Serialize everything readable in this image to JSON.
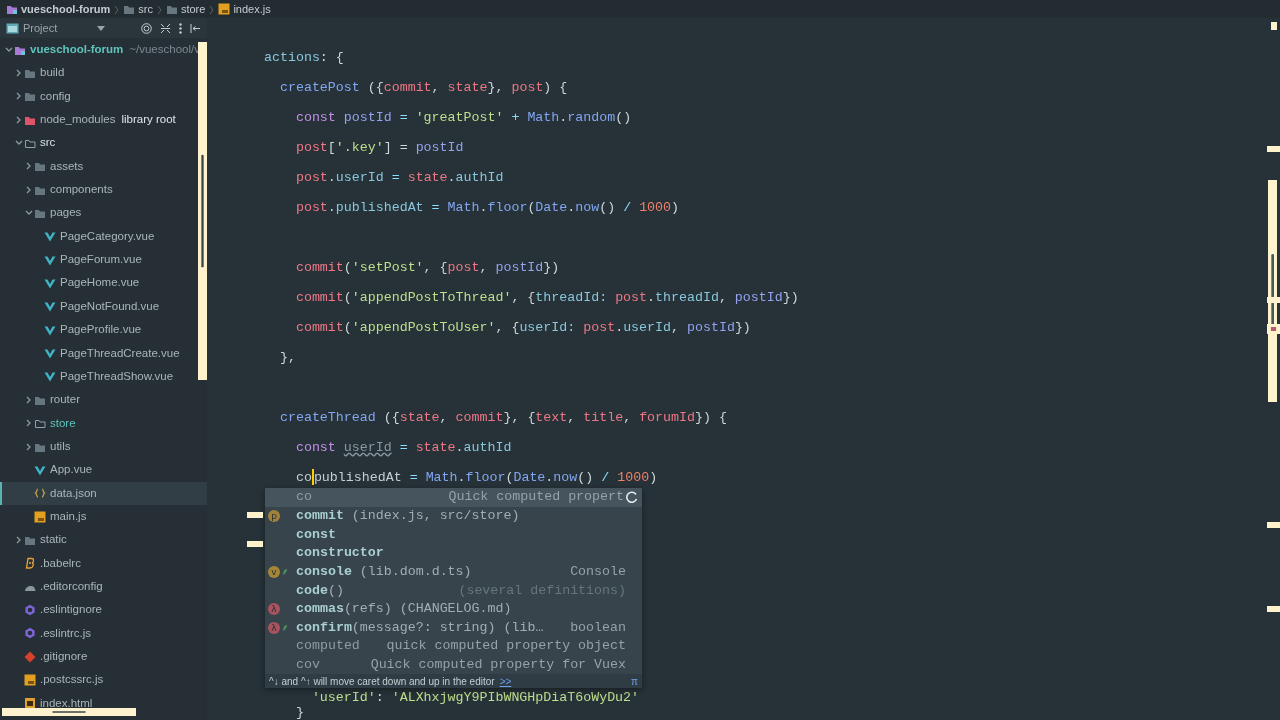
{
  "breadcrumbs": [
    {
      "label": "vueschool-forum",
      "kind": "module"
    },
    {
      "label": "src",
      "kind": "folder"
    },
    {
      "label": "store",
      "kind": "folder"
    },
    {
      "label": "index.js",
      "kind": "js"
    }
  ],
  "project_panel": {
    "title": "Project",
    "tree": [
      {
        "name": "vueschool-forum",
        "note": "~/vueschool/v",
        "kind": "module",
        "expanded": true,
        "selected": false,
        "active": true,
        "children": [
          {
            "name": "build",
            "kind": "folder",
            "expanded": false,
            "selected": false,
            "active": false
          },
          {
            "name": "config",
            "kind": "folder",
            "expanded": false,
            "selected": false,
            "active": false
          },
          {
            "name": "node_modules",
            "note": "library root",
            "kind": "library",
            "expanded": false,
            "selected": false,
            "active": false
          },
          {
            "name": "src",
            "kind": "source",
            "expanded": true,
            "selected": false,
            "active": false,
            "children": [
              {
                "name": "assets",
                "kind": "folder",
                "expanded": false,
                "selected": false,
                "active": false
              },
              {
                "name": "components",
                "kind": "folder",
                "expanded": false,
                "selected": false,
                "active": false
              },
              {
                "name": "pages",
                "kind": "folder",
                "expanded": true,
                "selected": false,
                "active": false,
                "children": [
                  {
                    "name": "PageCategory.vue",
                    "kind": "vue",
                    "selected": false,
                    "active": false
                  },
                  {
                    "name": "PageForum.vue",
                    "kind": "vue",
                    "selected": false,
                    "active": false
                  },
                  {
                    "name": "PageHome.vue",
                    "kind": "vue",
                    "selected": false,
                    "active": false
                  },
                  {
                    "name": "PageNotFound.vue",
                    "kind": "vue",
                    "selected": false,
                    "active": false
                  },
                  {
                    "name": "PageProfile.vue",
                    "kind": "vue",
                    "selected": false,
                    "active": false
                  },
                  {
                    "name": "PageThreadCreate.vue",
                    "kind": "vue",
                    "selected": false,
                    "active": false
                  },
                  {
                    "name": "PageThreadShow.vue",
                    "kind": "vue",
                    "selected": false,
                    "active": false
                  }
                ]
              },
              {
                "name": "router",
                "kind": "folder",
                "expanded": false,
                "selected": false,
                "active": false
              },
              {
                "name": "store",
                "kind": "source",
                "expanded": false,
                "selected": false,
                "active": true
              },
              {
                "name": "utils",
                "kind": "folder",
                "expanded": false,
                "selected": false,
                "active": false
              },
              {
                "name": "App.vue",
                "kind": "vue",
                "selected": false,
                "active": false
              },
              {
                "name": "data.json",
                "kind": "json",
                "selected": true,
                "active": false
              },
              {
                "name": "main.js",
                "kind": "js",
                "selected": false,
                "active": false
              }
            ]
          },
          {
            "name": "static",
            "kind": "folder",
            "expanded": false,
            "selected": false,
            "active": false
          },
          {
            "name": ".babelrc",
            "kind": "babel",
            "selected": false,
            "active": false
          },
          {
            "name": ".editorconfig",
            "kind": "editorconfig",
            "selected": false,
            "active": false
          },
          {
            "name": ".eslintignore",
            "kind": "eslint",
            "selected": false,
            "active": false
          },
          {
            "name": ".eslintrc.js",
            "kind": "eslint",
            "selected": false,
            "active": false
          },
          {
            "name": ".gitignore",
            "kind": "git",
            "selected": false,
            "active": false
          },
          {
            "name": ".postcssrc.js",
            "kind": "js",
            "selected": false,
            "active": false
          },
          {
            "name": "index.html",
            "kind": "html",
            "selected": false,
            "active": false
          }
        ]
      }
    ]
  },
  "editor": {
    "blocks": [
      [
        [
          {
            "t": "actions",
            "kind": "prop"
          },
          {
            "t": ": {",
            "kind": "punc"
          }
        ],
        [
          {
            "t": "  createPost",
            "kind": "fn"
          },
          {
            "t": " ({",
            "kind": "punc"
          },
          {
            "t": "commit",
            "kind": "param"
          },
          {
            "t": ", ",
            "kind": "punc"
          },
          {
            "t": "state",
            "kind": "param"
          },
          {
            "t": "}, ",
            "kind": "punc"
          },
          {
            "t": "post",
            "kind": "param"
          },
          {
            "t": ") {",
            "kind": "punc"
          }
        ],
        [
          {
            "t": "    const ",
            "kind": "kw"
          },
          {
            "t": "postId",
            "kind": "var"
          },
          {
            "t": " = ",
            "kind": "op"
          },
          {
            "t": "'greatPost'",
            "kind": "str"
          },
          {
            "t": " + ",
            "kind": "op"
          },
          {
            "t": "Math",
            "kind": "fn"
          },
          {
            "t": ".",
            "kind": "punc"
          },
          {
            "t": "random",
            "kind": "fn"
          },
          {
            "t": "()",
            "kind": "punc"
          }
        ],
        [
          {
            "t": "    post",
            "kind": "param"
          },
          {
            "t": "[",
            "kind": "punc"
          },
          {
            "t": "'.key'",
            "kind": "str"
          },
          {
            "t": "] = ",
            "kind": "punc"
          },
          {
            "t": "postId",
            "kind": "var"
          }
        ],
        [
          {
            "t": "    post",
            "kind": "param"
          },
          {
            "t": ".",
            "kind": "punc"
          },
          {
            "t": "userId",
            "kind": "prop"
          },
          {
            "t": " = ",
            "kind": "op"
          },
          {
            "t": "state",
            "kind": "param"
          },
          {
            "t": ".",
            "kind": "punc"
          },
          {
            "t": "authId",
            "kind": "prop"
          }
        ],
        [
          {
            "t": "    post",
            "kind": "param"
          },
          {
            "t": ".",
            "kind": "punc"
          },
          {
            "t": "publishedAt",
            "kind": "prop"
          },
          {
            "t": " = ",
            "kind": "op"
          },
          {
            "t": "Math",
            "kind": "fn"
          },
          {
            "t": ".",
            "kind": "punc"
          },
          {
            "t": "floor",
            "kind": "fn"
          },
          {
            "t": "(",
            "kind": "punc"
          },
          {
            "t": "Date",
            "kind": "fn"
          },
          {
            "t": ".",
            "kind": "punc"
          },
          {
            "t": "now",
            "kind": "fn"
          },
          {
            "t": "() ",
            "kind": "punc"
          },
          {
            "t": "/ ",
            "kind": "op"
          },
          {
            "t": "1000",
            "kind": "num"
          },
          {
            "t": ")",
            "kind": "punc"
          }
        ]
      ],
      [
        [
          {
            "t": "    commit",
            "kind": "param"
          },
          {
            "t": "(",
            "kind": "punc"
          },
          {
            "t": "'setPost'",
            "kind": "str"
          },
          {
            "t": ", {",
            "kind": "punc"
          },
          {
            "t": "post",
            "kind": "param"
          },
          {
            "t": ", ",
            "kind": "punc"
          },
          {
            "t": "postId",
            "kind": "var"
          },
          {
            "t": "})",
            "kind": "punc"
          }
        ],
        [
          {
            "t": "    commit",
            "kind": "param"
          },
          {
            "t": "(",
            "kind": "punc"
          },
          {
            "t": "'appendPostToThread'",
            "kind": "str"
          },
          {
            "t": ", {",
            "kind": "punc"
          },
          {
            "t": "threadId: ",
            "kind": "prop"
          },
          {
            "t": "post",
            "kind": "param"
          },
          {
            "t": ".",
            "kind": "punc"
          },
          {
            "t": "threadId",
            "kind": "prop"
          },
          {
            "t": ", ",
            "kind": "punc"
          },
          {
            "t": "postId",
            "kind": "var"
          },
          {
            "t": "})",
            "kind": "punc"
          }
        ],
        [
          {
            "t": "    commit",
            "kind": "param"
          },
          {
            "t": "(",
            "kind": "punc"
          },
          {
            "t": "'appendPostToUser'",
            "kind": "str"
          },
          {
            "t": ", {",
            "kind": "punc"
          },
          {
            "t": "userId: ",
            "kind": "prop"
          },
          {
            "t": "post",
            "kind": "param"
          },
          {
            "t": ".",
            "kind": "punc"
          },
          {
            "t": "userId",
            "kind": "prop"
          },
          {
            "t": ", ",
            "kind": "punc"
          },
          {
            "t": "postId",
            "kind": "var"
          },
          {
            "t": "})",
            "kind": "punc"
          }
        ],
        [
          {
            "t": "  },",
            "kind": "punc"
          }
        ]
      ],
      [
        [
          {
            "t": "  createThread",
            "kind": "fn"
          },
          {
            "t": " ({",
            "kind": "punc"
          },
          {
            "t": "state",
            "kind": "param"
          },
          {
            "t": ", ",
            "kind": "punc"
          },
          {
            "t": "commit",
            "kind": "param"
          },
          {
            "t": "}, {",
            "kind": "punc"
          },
          {
            "t": "text",
            "kind": "param"
          },
          {
            "t": ", ",
            "kind": "punc"
          },
          {
            "t": "title",
            "kind": "param"
          },
          {
            "t": ", ",
            "kind": "punc"
          },
          {
            "t": "forumId",
            "kind": "param"
          },
          {
            "t": "}) {",
            "kind": "punc"
          }
        ],
        [
          {
            "t": "    const ",
            "kind": "kw"
          },
          {
            "t": "userId",
            "kind": "unused"
          },
          {
            "t": " = ",
            "kind": "op"
          },
          {
            "t": "state",
            "kind": "param"
          },
          {
            "t": ".",
            "kind": "punc"
          },
          {
            "t": "authId",
            "kind": "prop"
          }
        ],
        [
          {
            "t": "    co",
            "kind": "plain",
            "caret": true
          },
          {
            "t": "publishedAt",
            "kind": "plain"
          },
          {
            "t": " = ",
            "kind": "op"
          },
          {
            "t": "Math",
            "kind": "fn"
          },
          {
            "t": ".",
            "kind": "punc"
          },
          {
            "t": "floor",
            "kind": "fn"
          },
          {
            "t": "(",
            "kind": "punc"
          },
          {
            "t": "Date",
            "kind": "fn"
          },
          {
            "t": ".",
            "kind": "punc"
          },
          {
            "t": "now",
            "kind": "fn"
          },
          {
            "t": "() ",
            "kind": "punc"
          },
          {
            "t": "/ ",
            "kind": "op"
          },
          {
            "t": "1000",
            "kind": "num"
          },
          {
            "t": ")",
            "kind": "punc"
          }
        ]
      ]
    ],
    "lines_below_popup": [
      [
        {
          "t": "      'userId'",
          "kind": "str"
        },
        {
          "t": ": ",
          "kind": "punc"
        },
        {
          "t": "'ALXhxjwgY9PIbWNGHpDiaT6oWyDu2'",
          "kind": "str"
        }
      ],
      [
        {
          "t": "    }",
          "kind": "punc"
        }
      ]
    ]
  },
  "completion": {
    "items": [
      {
        "name": "co",
        "bold": false,
        "tail": "Quick computed propert",
        "selected": true,
        "loading": true
      },
      {
        "name": "commit",
        "bold": true,
        "detail": " (index.js, src/store)",
        "badge": "p",
        "color": "#a2823a",
        "selected": false
      },
      {
        "name": "const",
        "bold": true,
        "selected": false
      },
      {
        "name": "constructor",
        "bold": true,
        "selected": false
      },
      {
        "name": "console",
        "bold": true,
        "detail": " (lib.dom.d.ts)",
        "tail": "Console",
        "badge": "v",
        "color": "#a58636",
        "pinned": true,
        "selected": false
      },
      {
        "name": "code",
        "bold": true,
        "detail": "()",
        "tail": "(several definitions)",
        "tail_dim": true,
        "selected": false
      },
      {
        "name": "commas",
        "bold": true,
        "detail": "(refs) (CHANGELOG.md)",
        "badge": "λ",
        "color": "#a8535e",
        "selected": false
      },
      {
        "name": "confirm",
        "bold": true,
        "detail": "(message?: string) (lib…",
        "tail": "boolean",
        "badge": "λ",
        "color": "#a8535e",
        "pinned": true,
        "selected": false
      },
      {
        "name": "computed",
        "bold": false,
        "tail": "quick computed property object",
        "selected": false
      },
      {
        "name": "cov",
        "bold": false,
        "tail": "Quick computed property for Vuex",
        "selected": false
      }
    ],
    "hint": "^↓ and ^↑ will move caret down and up in the editor",
    "hint_link": ">>",
    "corner": "π"
  }
}
